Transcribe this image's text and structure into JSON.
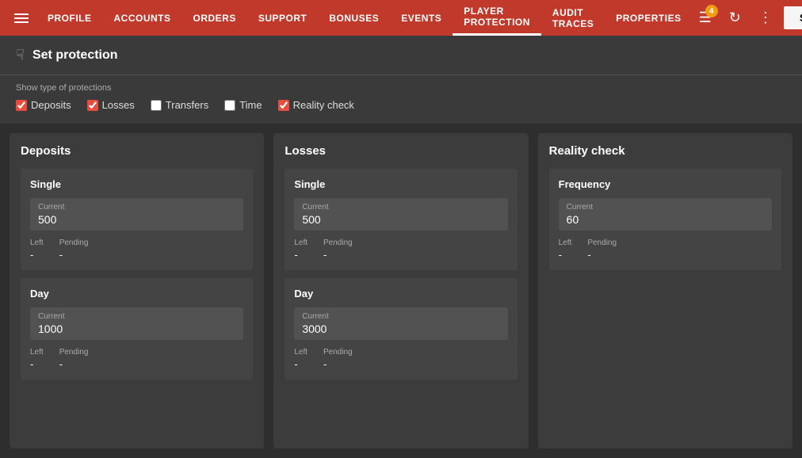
{
  "nav": {
    "items": [
      {
        "label": "PROFILE",
        "active": false
      },
      {
        "label": "ACCOUNTS",
        "active": false
      },
      {
        "label": "ORDERS",
        "active": false
      },
      {
        "label": "SUPPORT",
        "active": false
      },
      {
        "label": "BONUSES",
        "active": false
      },
      {
        "label": "EVENTS",
        "active": false
      },
      {
        "label": "PLAYER PROTECTION",
        "active": true
      },
      {
        "label": "AUDIT TRACES",
        "active": false
      },
      {
        "label": "PROPERTIES",
        "active": false
      }
    ],
    "badge_count": "4",
    "save_label": "Save"
  },
  "header": {
    "title": "Set protection"
  },
  "filters": {
    "label": "Show type of protections",
    "items": [
      {
        "label": "Deposits",
        "checked": true
      },
      {
        "label": "Losses",
        "checked": true
      },
      {
        "label": "Transfers",
        "checked": false
      },
      {
        "label": "Time",
        "checked": false
      },
      {
        "label": "Reality check",
        "checked": true
      }
    ]
  },
  "deposits": {
    "title": "Deposits",
    "single": {
      "title": "Single",
      "current_label": "Current",
      "current_value": "500",
      "left_label": "Left",
      "left_value": "-",
      "pending_label": "Pending",
      "pending_value": "-"
    },
    "day": {
      "title": "Day",
      "current_label": "Current",
      "current_value": "1000",
      "left_label": "Left",
      "left_value": "-",
      "pending_label": "Pending",
      "pending_value": "-"
    }
  },
  "losses": {
    "title": "Losses",
    "single": {
      "title": "Single",
      "current_label": "Current",
      "current_value": "500",
      "left_label": "Left",
      "left_value": "-",
      "pending_label": "Pending",
      "pending_value": "-"
    },
    "day": {
      "title": "Day",
      "current_label": "Current",
      "current_value": "3000",
      "left_label": "Left",
      "left_value": "-",
      "pending_label": "Pending",
      "pending_value": "-"
    }
  },
  "reality_check": {
    "title": "Reality check",
    "frequency": {
      "title": "Frequency",
      "current_label": "Current",
      "current_value": "60",
      "left_label": "Left",
      "left_value": "-",
      "pending_label": "Pending",
      "pending_value": "-"
    }
  }
}
